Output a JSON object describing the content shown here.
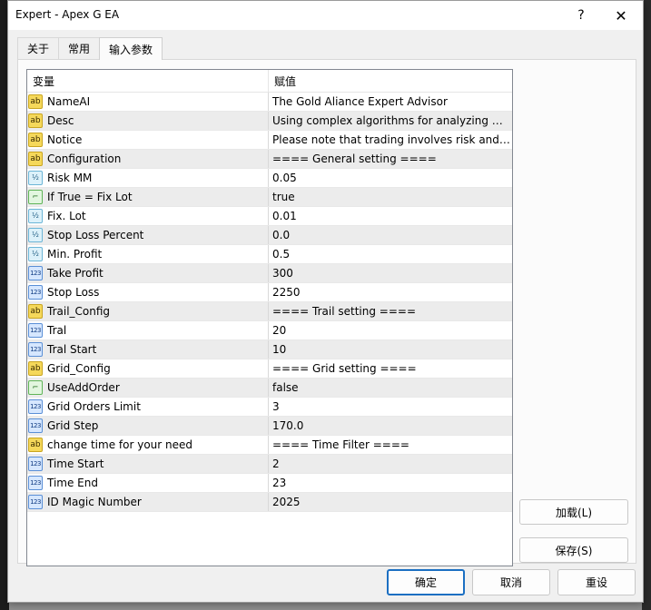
{
  "window": {
    "title": "Expert - Apex G EA",
    "help_glyph": "?",
    "close_glyph": "✕"
  },
  "tabs": [
    {
      "label": "关于",
      "active": false
    },
    {
      "label": "常用",
      "active": false
    },
    {
      "label": "输入参数",
      "active": true
    }
  ],
  "grid": {
    "headers": {
      "variable": "变量",
      "value": "赋值"
    },
    "rows": [
      {
        "type": "ab",
        "name": "NameAI",
        "value": "The Gold Aliance Expert Advisor"
      },
      {
        "type": "ab",
        "name": "Desc",
        "value": "Using complex algorithms for analyzing m..."
      },
      {
        "type": "ab",
        "name": "Notice",
        "value": "Please note that trading involves risk and i..."
      },
      {
        "type": "ab",
        "name": "Configuration",
        "value": "==== General setting ===="
      },
      {
        "type": "frac",
        "name": "Risk MM",
        "value": "0.05"
      },
      {
        "type": "bool",
        "name": "If True = Fix Lot",
        "value": "true"
      },
      {
        "type": "frac",
        "name": "Fix. Lot",
        "value": "0.01"
      },
      {
        "type": "frac",
        "name": "Stop Loss Percent",
        "value": "0.0"
      },
      {
        "type": "frac",
        "name": "Min. Profit",
        "value": "0.5"
      },
      {
        "type": "int",
        "name": "Take Profit",
        "value": "300"
      },
      {
        "type": "int",
        "name": "Stop Loss",
        "value": "2250"
      },
      {
        "type": "ab",
        "name": "Trail_Config",
        "value": "==== Trail setting ===="
      },
      {
        "type": "int",
        "name": "Tral",
        "value": "20"
      },
      {
        "type": "int",
        "name": "Tral Start",
        "value": "10"
      },
      {
        "type": "ab",
        "name": "Grid_Config",
        "value": "==== Grid setting ===="
      },
      {
        "type": "bool",
        "name": "UseAddOrder",
        "value": "false"
      },
      {
        "type": "int",
        "name": "Grid Orders Limit",
        "value": "3"
      },
      {
        "type": "int",
        "name": "Grid Step",
        "value": "170.0"
      },
      {
        "type": "ab",
        "name": "change time for your need",
        "value": "==== Time Filter ===="
      },
      {
        "type": "int",
        "name": "Time Start",
        "value": "2"
      },
      {
        "type": "int",
        "name": "Time End",
        "value": "23"
      },
      {
        "type": "int",
        "name": "ID Magic Number",
        "value": "2025"
      }
    ]
  },
  "icons": {
    "ab": {
      "glyph": "ab",
      "semantic": "string-param-icon"
    },
    "frac": {
      "glyph": "½",
      "semantic": "double-param-icon"
    },
    "int": {
      "glyph": "123",
      "semantic": "integer-param-icon"
    },
    "bool": {
      "glyph": "⌐",
      "semantic": "bool-param-icon"
    }
  },
  "buttons": {
    "load": "加载(L)",
    "save": "保存(S)",
    "ok": "确定",
    "cancel": "取消",
    "reset": "重设"
  },
  "colors": {
    "primary_border": "#1b6fc2",
    "alt_row": "#ececec"
  }
}
